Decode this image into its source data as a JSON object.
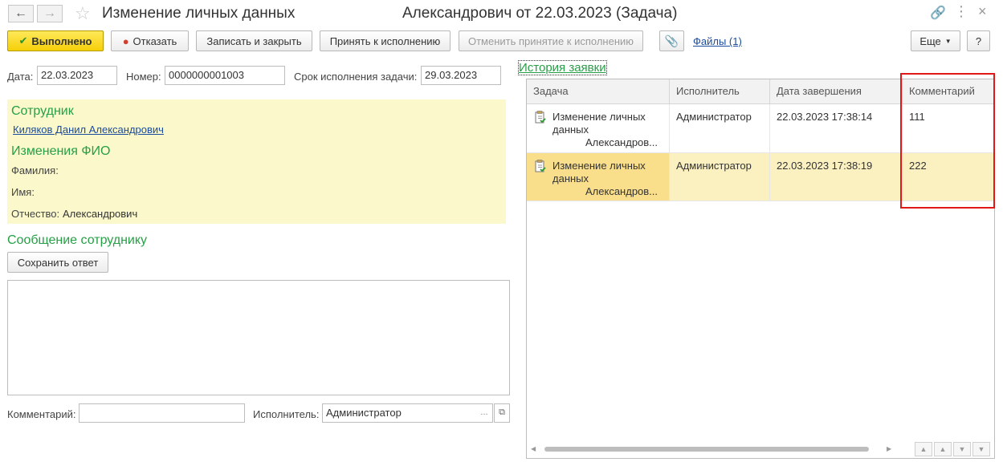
{
  "header": {
    "back_icon": "arrow-left-icon",
    "forward_icon": "arrow-right-icon",
    "star_icon": "star-icon",
    "title_left": "Изменение личных данных",
    "title_right": "Александрович от 22.03.2023 (Задача)"
  },
  "toolbar": {
    "done_label": "Выполнено",
    "reject_label": "Отказать",
    "save_close_label": "Записать и закрыть",
    "accept_label": "Принять к исполнению",
    "cancel_accept_label": "Отменить принятие к исполнению",
    "files_label": "Файлы (1)",
    "more_label": "Еще",
    "help_label": "?"
  },
  "form": {
    "date_label": "Дата:",
    "date_value": "22.03.2023",
    "number_label": "Номер:",
    "number_value": "0000000001003",
    "deadline_label": "Срок исполнения задачи:",
    "deadline_value": "29.03.2023"
  },
  "employee": {
    "heading": "Сотрудник",
    "name": "Киляков Данил Александрович",
    "changes_heading": "Изменения ФИО",
    "last_name_label": "Фамилия:",
    "first_name_label": "Имя:",
    "middle_name_label": "Отчество:",
    "middle_name_value": "Александрович"
  },
  "message": {
    "heading": "Сообщение сотруднику",
    "save_answer_label": "Сохранить ответ",
    "comment_label": "Комментарий:",
    "executor_label": "Исполнитель:",
    "executor_value": "Администратор",
    "more_dots": "..."
  },
  "history": {
    "title": "История заявки",
    "columns": [
      "Задача",
      "Исполнитель",
      "Дата завершения",
      "Комментарий"
    ],
    "rows": [
      {
        "task_line1": "Изменение личных",
        "task_line2": "данных",
        "task_line3": "Александров...",
        "executor": "Администратор",
        "date": "22.03.2023 17:38:14",
        "comment": "111"
      },
      {
        "task_line1": "Изменение личных",
        "task_line2": "данных",
        "task_line3": "Александров...",
        "executor": "Администратор",
        "date": "22.03.2023 17:38:19",
        "comment": "222"
      }
    ]
  }
}
